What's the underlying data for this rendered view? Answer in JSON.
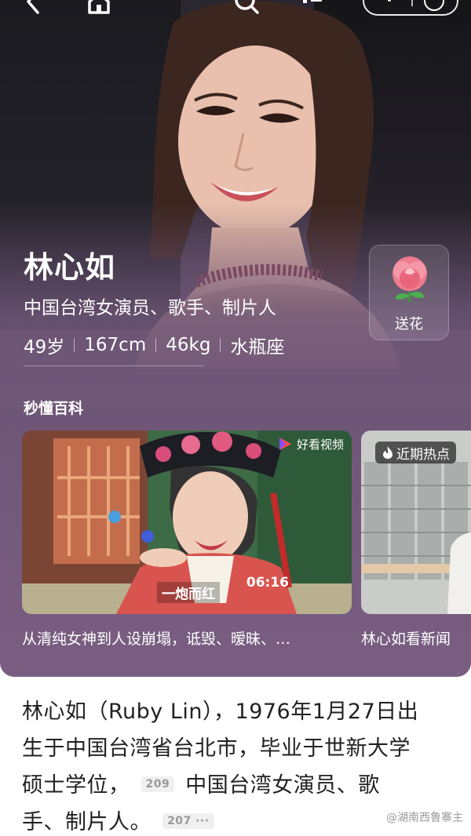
{
  "profile": {
    "name": "林心如",
    "description": "中国台湾女演员、歌手、制片人",
    "stats": [
      "49岁",
      "167cm",
      "46kg",
      "水瓶座"
    ],
    "flower_label": "送花"
  },
  "section": {
    "title": "秒懂百科"
  },
  "cards": [
    {
      "source": "好看视频",
      "duration": "06:16",
      "overlay_text": "一炮而红",
      "caption": "从清纯女神到人设崩塌，诋毁、暧昧、…"
    },
    {
      "badge": "近期热点",
      "caption": "林心如看新闻"
    }
  ],
  "article": {
    "line1": "林心如（Ruby Lin），1976年1月27日出",
    "line2": "生于中国台湾省台北市，毕业于世新大学",
    "line3a": "硕士学位，",
    "ref1": "209",
    "line3b": "中国台湾女演员、歌",
    "line4": "手、制片人。",
    "ref2": "207 ···"
  },
  "watermark": "@湖南西鲁寨主",
  "icons": [
    "back-icon",
    "home-icon",
    "search-icon",
    "listen-icon",
    "more-icon",
    "close-icon",
    "rose-icon",
    "fire-icon",
    "play-logo-icon"
  ],
  "colors": {
    "hero_purple": "#6f5778",
    "text_dark": "#222222"
  }
}
